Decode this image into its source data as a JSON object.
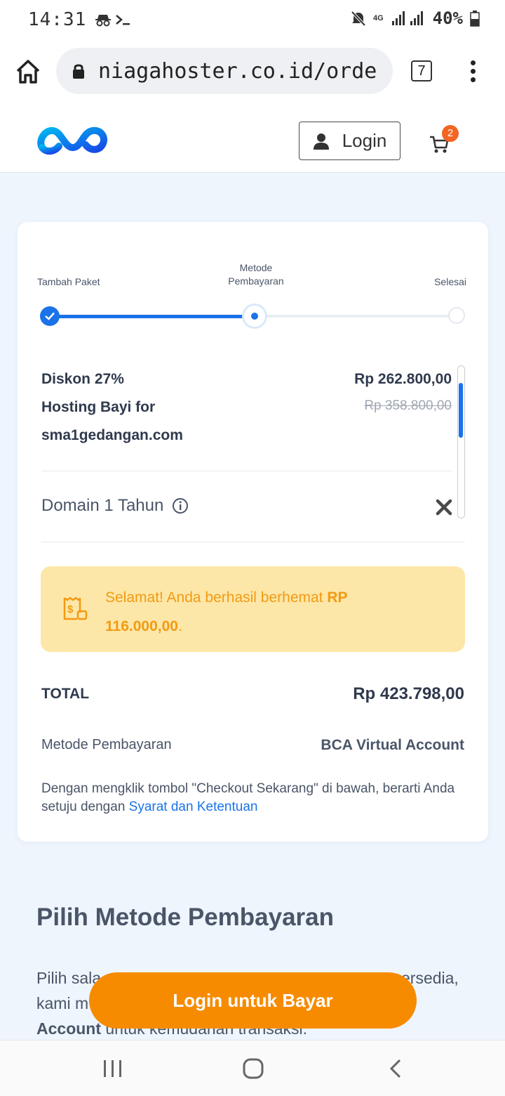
{
  "status_bar": {
    "time": "14:31",
    "battery": "40%",
    "network": "4G"
  },
  "browser": {
    "url": "niagahoster.co.id/orde",
    "tab_count": "7"
  },
  "header": {
    "login_label": "Login",
    "cart_count": "2"
  },
  "stepper": {
    "steps": [
      "Tambah Paket",
      "Metode\nPembayaran",
      "Selesai"
    ],
    "current_index": 1
  },
  "order": {
    "item_lines": [
      "Diskon 27%",
      "Hosting Bayi for",
      "sma1gedangan.com"
    ],
    "price": "Rp 262.800,00",
    "old_price": "Rp 358.800,00",
    "domain_label": "Domain 1 Tahun"
  },
  "promo": {
    "text": "Selamat! Anda berhasil berhemat ",
    "amount": "RP 116.000,00",
    "suffix": "."
  },
  "summary": {
    "total_label": "TOTAL",
    "total_value": "Rp 423.798,00",
    "method_label": "Metode Pembayaran",
    "method_value": "BCA Virtual Account",
    "terms_text": "Dengan mengklik tombol \"Checkout Sekarang\" di bawah, berarti Anda setuju dengan ",
    "terms_link": "Syarat dan Ketentuan"
  },
  "section": {
    "title": "Pilih Metode Pembayaran",
    "body_line1": "Pilih sala",
    "body_line1_end": "ersedia,",
    "body_line2": "kami m",
    "body_line3_bold": "Account",
    "body_line3_rest": " untuk kemudahan transaksi."
  },
  "cta": {
    "label": "Login untuk Bayar"
  },
  "colors": {
    "primary": "#1a73e8",
    "accent": "#f78b00",
    "promo_bg": "#fde7a8",
    "badge": "#f26522"
  }
}
